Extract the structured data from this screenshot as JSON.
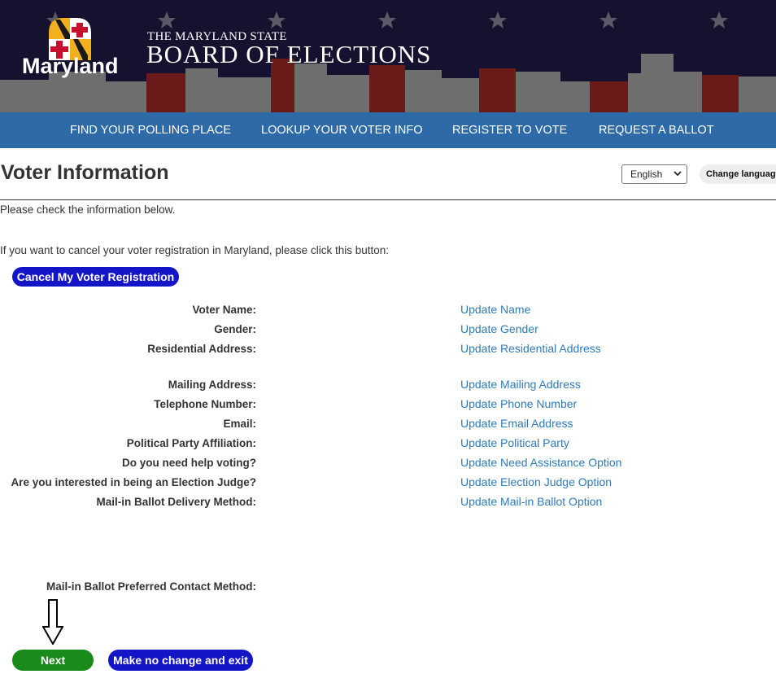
{
  "header": {
    "logo_text": "Maryland",
    "title_small": "THE MARYLAND STATE",
    "title_big": "BOARD OF ELECTIONS",
    "colors": {
      "banner": "#14122e",
      "skyline_gray": "#6e6e6e",
      "skyline_red": "#6b1a1a"
    }
  },
  "nav": {
    "items": [
      {
        "label": "FIND YOUR POLLING PLACE"
      },
      {
        "label": "LOOKUP YOUR VOTER INFO"
      },
      {
        "label": "REGISTER TO VOTE"
      },
      {
        "label": "REQUEST A BALLOT"
      }
    ]
  },
  "page": {
    "title": "Voter Information",
    "language_selected": "English",
    "change_language_label": "Change language",
    "intro": "Please check the information below.",
    "cancel_prompt": "If you want to cancel your voter registration in Maryland, please click this button:",
    "cancel_button": "Cancel My Voter Registration"
  },
  "fields": [
    {
      "label": "Voter Name:",
      "link": "Update Name"
    },
    {
      "label": "Gender:",
      "link": "Update Gender"
    },
    {
      "label": "Residential Address:",
      "link": "Update Residential Address"
    },
    {
      "label": "Mailing Address:",
      "link": "Update Mailing Address"
    },
    {
      "label": "Telephone Number:",
      "link": "Update Phone Number"
    },
    {
      "label": "Email:",
      "link": "Update Email Address"
    },
    {
      "label": "Political Party Affiliation:",
      "link": "Update Political Party"
    },
    {
      "label": "Do you need help voting?",
      "link": "Update Need Assistance Option"
    },
    {
      "label": "Are you interested in being an Election Judge?",
      "link": "Update Election Judge Option"
    },
    {
      "label": "Mail-in Ballot Delivery Method:",
      "link": "Update Mail-in Ballot Option"
    }
  ],
  "preferred_contact_label": "Mail-in Ballot Preferred Contact Method:",
  "actions": {
    "next": "Next",
    "exit": "Make no change and exit"
  },
  "colors": {
    "nav_bg": "#2d6aa7",
    "link": "#2f7ab9",
    "button_blue": "#1515c8",
    "button_green": "#1a8a1a"
  }
}
